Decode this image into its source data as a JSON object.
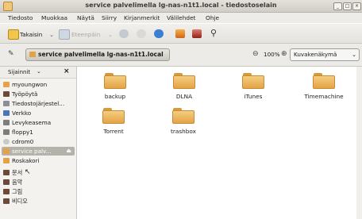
{
  "window": {
    "title": "service palvelimella lg-nas-n1t1.local - tiedostoselain",
    "controls": [
      "_",
      "□",
      "×"
    ]
  },
  "menubar": {
    "items": [
      "Tiedosto",
      "Muokkaa",
      "Näytä",
      "Siirry",
      "Kirjanmerkit",
      "Välilehdet",
      "Ohje"
    ]
  },
  "toolbar": {
    "back_label": "Takaisin",
    "forward_label": "Eteenpäin"
  },
  "location": {
    "path": "service palvelimella lg-nas-n1t1.local",
    "zoom": "100%",
    "view_mode": "Kuvakenäkymä"
  },
  "sidebar": {
    "header": "Sijainnit",
    "items": [
      {
        "label": "myoungwon",
        "icon": "home-folder-icon"
      },
      {
        "label": "Työpöytä",
        "icon": "desktop-icon"
      },
      {
        "label": "Tiedostojärjestel...",
        "icon": "filesystem-icon"
      },
      {
        "label": "Verkko",
        "icon": "network-icon"
      },
      {
        "label": "Levykeasema",
        "icon": "floppy-drive-icon"
      },
      {
        "label": "floppy1",
        "icon": "floppy-icon"
      },
      {
        "label": "cdrom0",
        "icon": "cdrom-icon"
      },
      {
        "label": "service palv...",
        "icon": "network-share-icon"
      },
      {
        "label": "Roskakori",
        "icon": "trash-icon"
      },
      {
        "label": "문서",
        "icon": "documents-folder-icon"
      },
      {
        "label": "음악",
        "icon": "music-folder-icon"
      },
      {
        "label": "그림",
        "icon": "pictures-folder-icon"
      },
      {
        "label": "비디오",
        "icon": "videos-folder-icon"
      }
    ]
  },
  "folders": [
    {
      "name": "backup"
    },
    {
      "name": "DLNA"
    },
    {
      "name": "iTunes"
    },
    {
      "name": "Timemachine"
    },
    {
      "name": "Torrent"
    },
    {
      "name": "trashbox"
    }
  ],
  "colors": {
    "folder_top": "#f6cd80",
    "folder_bottom": "#e3a445",
    "selection": "#b4b2aa"
  }
}
